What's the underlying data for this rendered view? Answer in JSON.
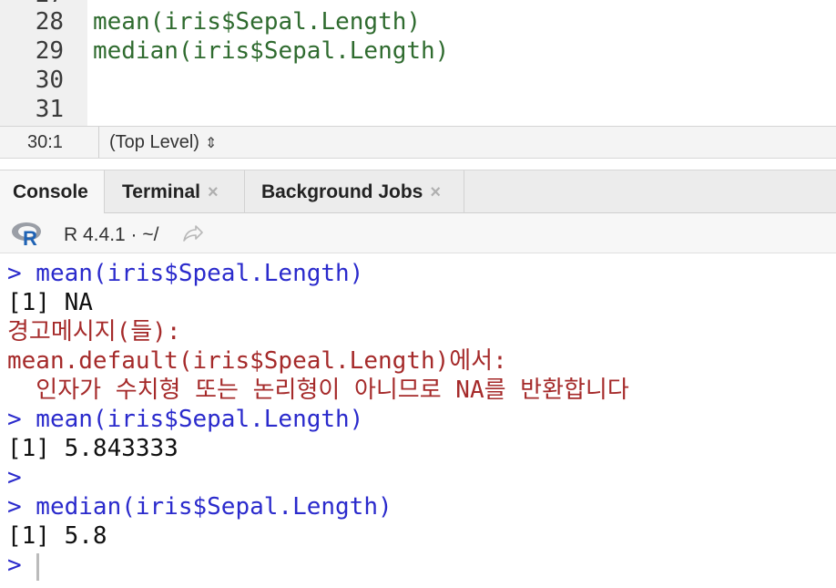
{
  "editor": {
    "lines": [
      {
        "num": "28",
        "code": "mean(iris$Sepal.Length)"
      },
      {
        "num": "29",
        "code": "median(iris$Sepal.Length)"
      },
      {
        "num": "30",
        "code": ""
      },
      {
        "num": "31",
        "code": ""
      }
    ]
  },
  "status": {
    "cursor_pos": "30:1",
    "scope": "(Top Level)",
    "scope_arrows": "⇕"
  },
  "tabs": [
    {
      "label": "Console",
      "close": ""
    },
    {
      "label": "Terminal",
      "close": "×"
    },
    {
      "label": "Background Jobs",
      "close": "×"
    }
  ],
  "console_header": {
    "r_version": "R 4.4.1  ·  ~/"
  },
  "console": {
    "lines": [
      {
        "text": "> mean(iris$Speal.Length)",
        "kind": "in"
      },
      {
        "text": "[1] NA",
        "kind": "out"
      },
      {
        "text": "경고메시지(들):",
        "kind": "warn"
      },
      {
        "text": "mean.default(iris$Speal.Length)에서:",
        "kind": "warn"
      },
      {
        "text": "  인자가 수치형 또는 논리형이 아니므로 NA를 반환합니다",
        "kind": "warn"
      },
      {
        "text": "> mean(iris$Sepal.Length)",
        "kind": "in"
      },
      {
        "text": "[1] 5.843333",
        "kind": "out"
      },
      {
        "text": ">",
        "kind": "in"
      },
      {
        "text": "> median(iris$Sepal.Length)",
        "kind": "in"
      },
      {
        "text": "[1] 5.8",
        "kind": "out"
      },
      {
        "text": ">",
        "kind": "in"
      }
    ]
  },
  "colors": {
    "code_green": "#2f6b2f",
    "input_blue": "#2a2acc",
    "warning_red": "#a52a2a"
  }
}
